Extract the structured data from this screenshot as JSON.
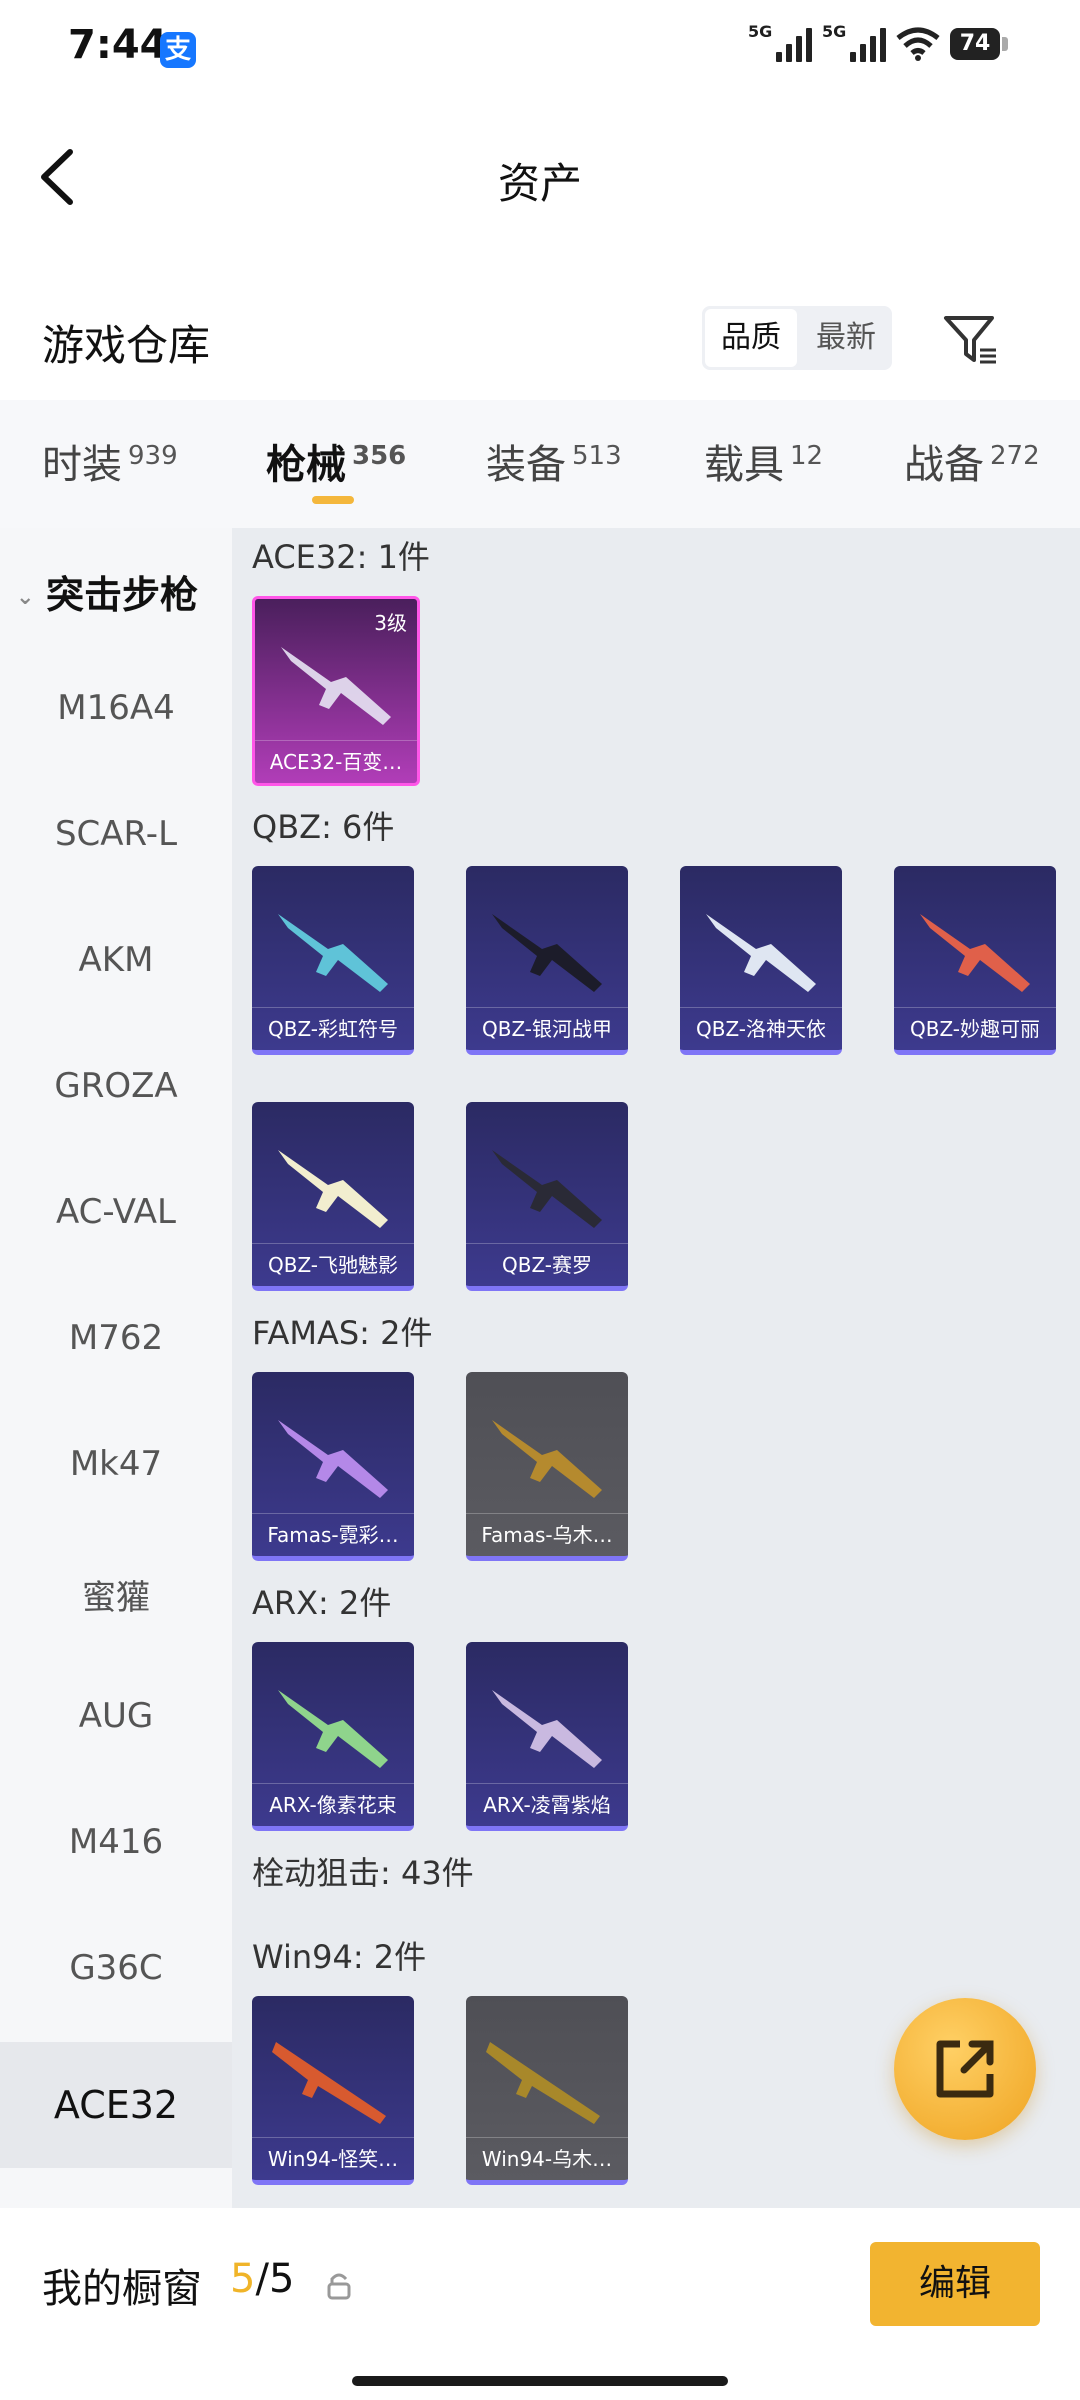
{
  "status": {
    "time": "7:44",
    "battery": "74",
    "net1": "5G",
    "net2": "5G",
    "app_badge": "支"
  },
  "nav": {
    "title": "资产"
  },
  "warehouse": {
    "title": "游戏仓库",
    "sort_quality": "品质",
    "sort_latest": "最新"
  },
  "tabs": [
    {
      "label": "时装",
      "count": "939"
    },
    {
      "label": "枪械",
      "count": "356"
    },
    {
      "label": "装备",
      "count": "513"
    },
    {
      "label": "载具",
      "count": "12"
    },
    {
      "label": "战备",
      "count": "272"
    }
  ],
  "sidebar": {
    "category": "突击步枪",
    "items": [
      "M16A4",
      "SCAR-L",
      "AKM",
      "GROZA",
      "AC-VAL",
      "M762",
      "Mk47",
      "蜜獾",
      "AUG",
      "M416",
      "G36C",
      "ACE32"
    ]
  },
  "sections": {
    "ace32": {
      "label": "ACE32: 1件",
      "items": [
        {
          "name": "ACE32-百变…",
          "level": "3级"
        }
      ]
    },
    "qbz": {
      "label": "QBZ: 6件",
      "items": [
        {
          "name": "QBZ-彩虹符号"
        },
        {
          "name": "QBZ-银河战甲"
        },
        {
          "name": "QBZ-洛神天依"
        },
        {
          "name": "QBZ-妙趣可丽"
        },
        {
          "name": "QBZ-飞驰魅影"
        },
        {
          "name": "QBZ-赛罗"
        }
      ]
    },
    "famas": {
      "label": "FAMAS: 2件",
      "items": [
        {
          "name": "Famas-霓彩…"
        },
        {
          "name": "Famas-乌木…"
        }
      ]
    },
    "arx": {
      "label": "ARX: 2件",
      "items": [
        {
          "name": "ARX-像素花束"
        },
        {
          "name": "ARX-凌霄紫焰"
        }
      ]
    },
    "bolt": {
      "label": "栓动狙击: 43件"
    },
    "win94": {
      "label": "Win94: 2件",
      "items": [
        {
          "name": "Win94-怪笑…"
        },
        {
          "name": "Win94-乌木…"
        }
      ]
    }
  },
  "bottom": {
    "title": "我的橱窗",
    "count_current": "5",
    "count_sep": "/",
    "count_total": "5",
    "edit": "编辑"
  },
  "colors": {
    "accent": "#f2b430",
    "card_purple": "#3d3a8e",
    "card_magenta": "#b13db8"
  }
}
